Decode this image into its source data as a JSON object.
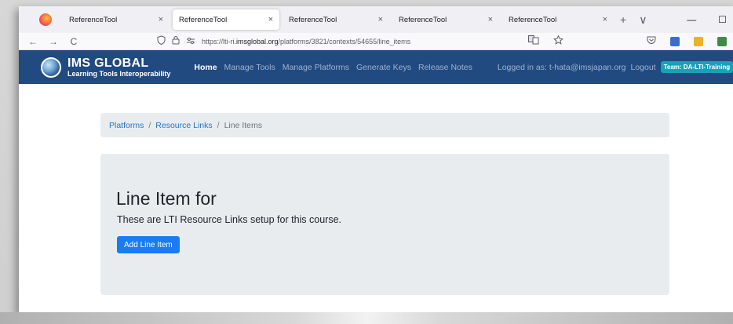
{
  "browser": {
    "tabs": [
      {
        "title": "ReferenceTool",
        "active": false
      },
      {
        "title": "ReferenceTool",
        "active": true
      },
      {
        "title": "ReferenceTool",
        "active": false
      },
      {
        "title": "ReferenceTool",
        "active": false
      },
      {
        "title": "ReferenceTool",
        "active": false
      }
    ],
    "close_glyph": "×",
    "new_tab_glyph": "+",
    "tab_list_glyph": "∨",
    "minimize_glyph": "—",
    "maximize_glyph": "☐",
    "back_glyph": "←",
    "forward_glyph": "→",
    "reload_glyph": "C",
    "url_prefix": "https://lti-ri.",
    "url_domain": "imsglobal.org",
    "url_path": "/platforms/3821/contexts/54655/line_items"
  },
  "site": {
    "logo_main": "IMS GLOBAL",
    "logo_sub": "Learning Tools Interoperability",
    "menu": [
      "Home",
      "Manage Tools",
      "Manage Platforms",
      "Generate Keys",
      "Release Notes"
    ],
    "active_menu": "Home",
    "logged_in": "Logged in as: t-hata@imsjapan.org",
    "logout": "Logout",
    "team_badge": "Team: DA-LTI-Training"
  },
  "breadcrumb": {
    "items": [
      "Platforms",
      "Resource Links"
    ],
    "separator": "/",
    "current": "Line Items"
  },
  "jumbotron": {
    "title": "Line Item for",
    "lead": "These are LTI Resource Links setup for this course.",
    "button": "Add Line Item"
  },
  "colors": {
    "header_bg": "#214a80",
    "primary": "#1a7cf5",
    "link": "#2475c7",
    "badge": "#17a2b8",
    "panel": "#e9ecef"
  }
}
